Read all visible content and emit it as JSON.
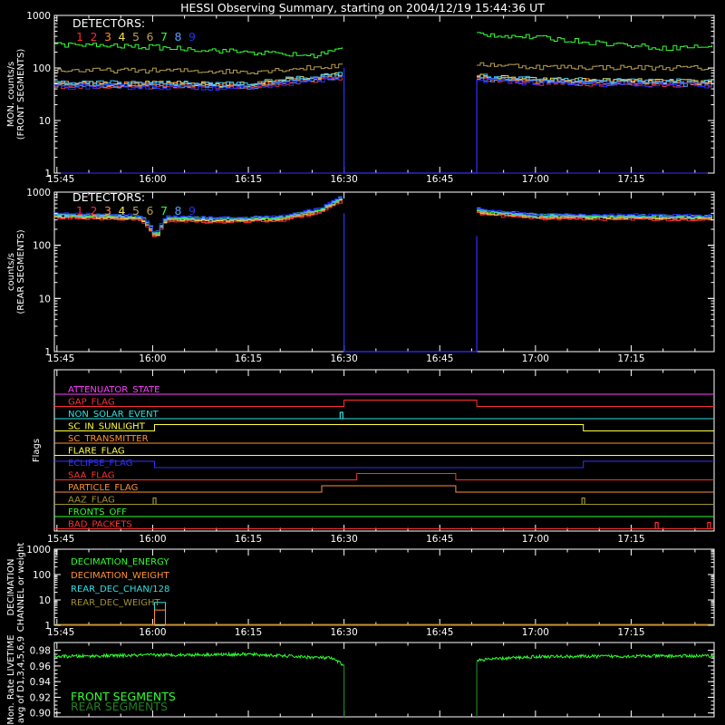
{
  "title": "HESSI Observing Summary, starting on 2004/12/19 15:44:36 UT",
  "time_ticks": [
    "15:45",
    "16:00",
    "16:15",
    "16:30",
    "16:45",
    "17:00",
    "17:15"
  ],
  "time_tick_minutes": [
    45,
    60,
    75,
    90,
    105,
    120,
    135
  ],
  "x_range_minutes": [
    44.6,
    148.0
  ],
  "colors": {
    "det": [
      "#ff2a2a",
      "#e8304a",
      "#ff8a2a",
      "#f0e050",
      "#b8a050",
      "#3cc8ff",
      "#30e030",
      "#50a0ff",
      "#2030ff"
    ],
    "green": "#30ff30",
    "red": "#ff3030",
    "blue": "#3030ff",
    "magenta": "#ff40ff",
    "cyan": "#30e0e0",
    "yellow": "#ffff40",
    "orange": "#ff9030",
    "olive": "#a09030"
  },
  "panels": {
    "front": {
      "ylabel1": "MON. counts/s",
      "ylabel2": "(FRONT SEGMENTS)",
      "yticks": [
        "1",
        "10",
        "100",
        "1000"
      ],
      "legend_title": "DETECTORS:",
      "legend_nums": [
        "1",
        "2",
        "3",
        "4",
        "5",
        "6",
        "7",
        "8",
        "9"
      ]
    },
    "rear": {
      "ylabel1": "counts/s",
      "ylabel2": "(REAR SEGMENTS)",
      "yticks": [
        "1",
        "10",
        "100",
        "1000"
      ],
      "legend_title": "DETECTORS:",
      "legend_nums": [
        "1",
        "2",
        "3",
        "4",
        "5",
        "6",
        "7",
        "8",
        "9"
      ]
    },
    "flags": {
      "ylabel": "Flags",
      "items": [
        {
          "name": "ATTENUATOR_STATE",
          "color": "#ff40ff",
          "steps": [
            [
              44.6,
              0
            ]
          ],
          "spikes": []
        },
        {
          "name": "GAP_FLAG",
          "color": "#ff3030",
          "steps": [
            [
              44.6,
              0
            ],
            [
              90.0,
              1
            ],
            [
              110.8,
              0
            ]
          ],
          "spikes": []
        },
        {
          "name": "NON_SOLAR_EVENT",
          "color": "#30e0e0",
          "steps": [
            [
              44.6,
              0
            ]
          ],
          "spikes": [
            89.6
          ]
        },
        {
          "name": "SC_IN_SUNLIGHT",
          "color": "#ffff40",
          "steps": [
            [
              44.6,
              0
            ],
            [
              60.3,
              1
            ],
            [
              127.5,
              0
            ]
          ],
          "spikes": []
        },
        {
          "name": "SC_TRANSMITTER",
          "color": "#ff9030",
          "steps": [
            [
              44.6,
              0
            ]
          ],
          "spikes": []
        },
        {
          "name": "FLARE_FLAG",
          "color": "#ffff40",
          "steps": [
            [
              44.6,
              0
            ]
          ],
          "spikes": []
        },
        {
          "name": "ECLIPSE_FLAG",
          "color": "#3030ff",
          "steps": [
            [
              44.6,
              1
            ],
            [
              60.3,
              0
            ],
            [
              127.5,
              1
            ]
          ],
          "spikes": []
        },
        {
          "name": "SAA_FLAG",
          "color": "#ff3030",
          "steps": [
            [
              44.6,
              0
            ],
            [
              92.0,
              1
            ],
            [
              107.5,
              0
            ]
          ],
          "spikes": []
        },
        {
          "name": "PARTICLE_FLAG",
          "color": "#ff9030",
          "steps": [
            [
              44.6,
              0
            ],
            [
              86.5,
              1
            ],
            [
              107.5,
              0
            ]
          ],
          "spikes": []
        },
        {
          "name": "AAZ_FLAG",
          "color": "#a09030",
          "steps": [
            [
              44.6,
              0
            ]
          ],
          "spikes": [
            60.3,
            127.5
          ]
        },
        {
          "name": "FRONTS_OFF",
          "color": "#30ff30",
          "steps": [
            [
              44.6,
              0
            ]
          ],
          "spikes": []
        },
        {
          "name": "BAD_PACKETS",
          "color": "#ff3030",
          "steps": [
            [
              44.6,
              0
            ]
          ],
          "spikes": [
            139.0,
            147.2
          ]
        }
      ]
    },
    "decim": {
      "ylabel1": "DECIMATION",
      "ylabel2": "CHANNEL or weight",
      "yticks": [
        "1",
        "10",
        "100",
        "1000"
      ],
      "legend": [
        {
          "label": "DECIMATION_ENERGY",
          "color": "#30ff30"
        },
        {
          "label": "DECIMATION_WEIGHT",
          "color": "#ff9030"
        },
        {
          "label": "REAR_DEC_CHAN/128",
          "color": "#30e0e0"
        },
        {
          "label": "REAR_DEC_WEIGHT",
          "color": "#a09030"
        }
      ]
    },
    "live": {
      "ylabel1": "Mon. Rate LIVETIME",
      "ylabel2": "avg of D1,3,4,5,6,9",
      "yticks": [
        "0.90",
        "0.92",
        "0.94",
        "0.96",
        "0.98"
      ],
      "legend": [
        {
          "label": "FRONT SEGMENTS",
          "color": "#30ff30"
        },
        {
          "label": "REAR SEGMENTS",
          "color": "#208020"
        }
      ]
    }
  },
  "chart_data": [
    {
      "type": "line",
      "title": "HESSI Observing Summary, starting on 2004/12/19 15:44:36 UT",
      "ylabel": "MON. counts/s (FRONT SEGMENTS)",
      "yscale": "log",
      "ylim": [
        1,
        1000
      ],
      "gap_minutes": [
        90.0,
        110.8
      ],
      "series": [
        {
          "name": "7",
          "x": [
            44.6,
            60,
            75,
            85,
            89.5,
            110.8,
            111.5,
            120,
            130,
            140,
            148
          ],
          "values": [
            280,
            250,
            200,
            170,
            230,
            460,
            440,
            380,
            300,
            240,
            260
          ]
        },
        {
          "name": "5",
          "x": [
            44.6,
            60,
            75,
            89.5,
            110.8,
            120,
            148
          ],
          "values": [
            90,
            90,
            85,
            110,
            120,
            105,
            100
          ]
        },
        {
          "name": "others",
          "x": [
            44.6,
            60,
            75,
            89.5,
            110.8,
            120,
            148
          ],
          "values": [
            48,
            47,
            45,
            70,
            65,
            55,
            50
          ]
        }
      ]
    },
    {
      "type": "line",
      "ylabel": "counts/s (REAR SEGMENTS)",
      "yscale": "log",
      "ylim": [
        1,
        1000
      ],
      "gap_minutes": [
        90.0,
        110.8
      ],
      "series": [
        {
          "name": "all",
          "x": [
            44.6,
            58,
            60.3,
            62,
            70,
            80,
            86,
            89.5,
            110.8,
            111.5,
            120,
            148
          ],
          "values": [
            360,
            330,
            140,
            320,
            300,
            320,
            450,
            750,
            450,
            420,
            350,
            330
          ]
        }
      ]
    },
    {
      "type": "line",
      "ylabel": "DECIMATION CHANNEL or weight",
      "yscale": "log",
      "ylim": [
        1,
        1000
      ],
      "series": [
        {
          "name": "REAR_DEC_CHAN/128",
          "x": [
            44.6,
            60.3,
            60.3,
            62.0,
            62.0,
            148
          ],
          "values": [
            1,
            1,
            8,
            8,
            1,
            1
          ]
        },
        {
          "name": "REAR_DEC_WEIGHT",
          "x": [
            44.6,
            60.3,
            60.3,
            62.0,
            62.0,
            148
          ],
          "values": [
            1,
            1,
            4,
            4,
            1,
            1
          ]
        }
      ]
    },
    {
      "type": "line",
      "ylabel": "Mon. Rate LIVETIME avg of D1,3,4,5,6,9",
      "ylim": [
        0.895,
        0.99
      ],
      "gap_minutes": [
        90.0,
        110.8
      ],
      "series": [
        {
          "name": "FRONT SEGMENTS",
          "x": [
            44.6,
            60,
            75,
            88,
            89.8,
            110.8,
            111.5,
            120,
            148
          ],
          "values": [
            0.972,
            0.974,
            0.975,
            0.97,
            0.962,
            0.966,
            0.968,
            0.972,
            0.973
          ]
        }
      ]
    }
  ]
}
